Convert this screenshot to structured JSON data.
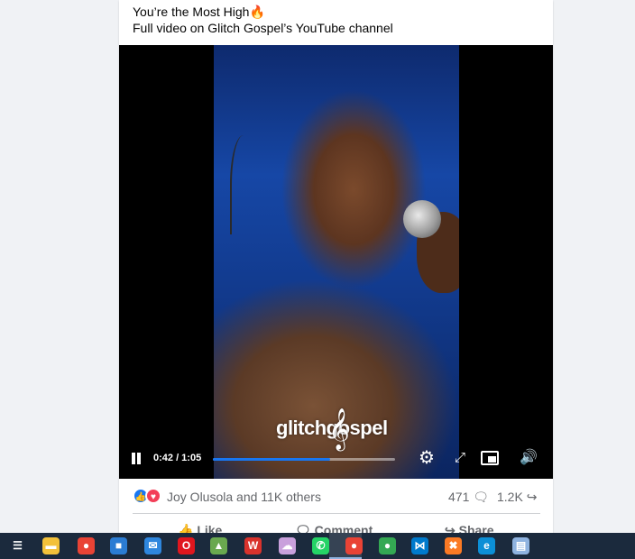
{
  "post": {
    "caption_line1": "You’re the Most High",
    "caption_emoji": "🔥",
    "caption_line2": "Full video on Glitch Gospel’s YouTube channel"
  },
  "video": {
    "watermark": "glitchgospel",
    "current_time": "0:42",
    "duration": "1:05",
    "time_display": "0:42 / 1:05",
    "progress_fraction": 0.646,
    "accent_color": "#1877f2"
  },
  "stats": {
    "reactions_text": "Joy Olusola and 11K others",
    "comment_count": "471",
    "share_count": "1.2K"
  },
  "actions": {
    "like_label": "Like",
    "comment_label": "Comment",
    "share_label": "Share"
  },
  "taskbar": {
    "items": [
      {
        "name": "task-view-icon",
        "color": "#1b2a3d"
      },
      {
        "name": "file-explorer-icon",
        "color": "#f3c13a"
      },
      {
        "name": "chrome-icon",
        "color": "#e94335"
      },
      {
        "name": "store-icon",
        "color": "#2b7cd3"
      },
      {
        "name": "mail-icon",
        "color": "#2e86de"
      },
      {
        "name": "opera-icon",
        "color": "#e0161e"
      },
      {
        "name": "app-icon",
        "color": "#6aa84f"
      },
      {
        "name": "wps-icon",
        "color": "#d9322c"
      },
      {
        "name": "cloud-icon",
        "color": "#c9a0dc"
      },
      {
        "name": "whatsapp-icon",
        "color": "#25d366"
      },
      {
        "name": "chrome-active-icon",
        "color": "#e94335"
      },
      {
        "name": "chrome-profile-icon",
        "color": "#34a853"
      },
      {
        "name": "vscode-icon",
        "color": "#007acc"
      },
      {
        "name": "xampp-icon",
        "color": "#fb7a24"
      },
      {
        "name": "edge-icon",
        "color": "#0c8fd6"
      },
      {
        "name": "notepad-icon",
        "color": "#8fb3e0"
      }
    ]
  }
}
